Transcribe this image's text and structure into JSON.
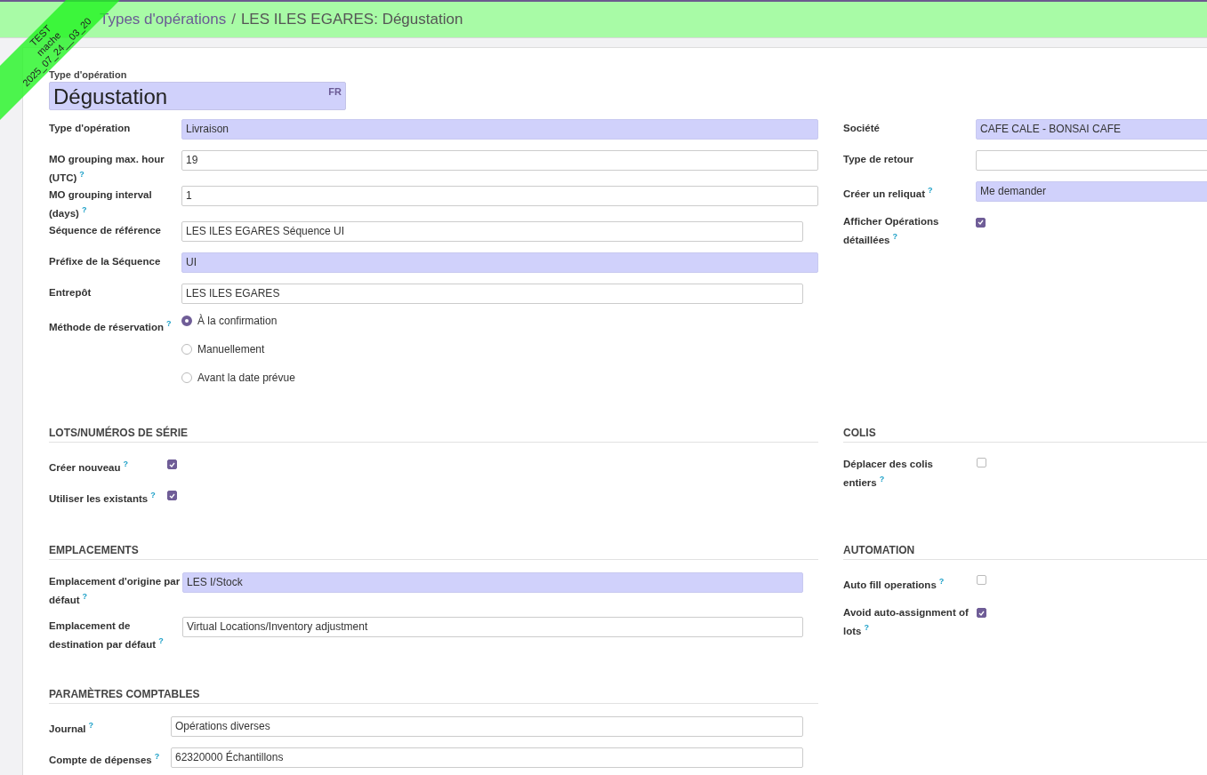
{
  "ribbon": {
    "lines": [
      "TEST",
      "mache",
      "2025_07_24__03_20"
    ]
  },
  "breadcrumb": [
    {
      "label": "Types d'opérations",
      "link": true
    },
    {
      "separator": "/",
      "label": "LES ILES EGARES: Dégustation",
      "link": false
    }
  ],
  "title_field": {
    "label": "Type d'opération",
    "value": "Dégustation",
    "lang": "FR"
  },
  "main_left": [
    {
      "label": "Type d'opération",
      "kind": "text",
      "value": "Livraison",
      "required": true
    },
    {
      "label": "MO grouping max. hour (UTC)",
      "help": "?",
      "kind": "text",
      "value": "19",
      "required": false
    },
    {
      "label": "MO grouping interval (days)",
      "help": "?",
      "kind": "text",
      "value": "1",
      "required": false
    },
    {
      "label": "Séquence de référence",
      "kind": "relation",
      "value": "LES ILES EGARES Séquence UI",
      "required": false
    },
    {
      "label": "Préfixe de la Séquence",
      "kind": "text",
      "value": "UI",
      "required": true
    },
    {
      "label": "Entrepôt",
      "kind": "relation",
      "value": "LES ILES EGARES",
      "required": false
    },
    {
      "label": "Méthode de réservation",
      "help": "?",
      "kind": "radio",
      "options": [
        {
          "label": "À la confirmation",
          "selected": true
        },
        {
          "label": "Manuellement",
          "selected": false
        },
        {
          "label": "Avant la date prévue",
          "selected": false
        }
      ]
    }
  ],
  "main_right": [
    {
      "label": "Société",
      "kind": "text",
      "value": "CAFE CALE - BONSAI CAFE",
      "required": true
    },
    {
      "label": "Type de retour",
      "kind": "text",
      "required": false
    },
    {
      "label": "Créer un reliquat",
      "help": "?",
      "kind": "text",
      "value": "Me demander",
      "required": true
    },
    {
      "label": "Afficher Opérations détaillées",
      "help": "?",
      "kind": "checkbox",
      "checked": true
    }
  ],
  "sections": [
    {
      "title": "LOTS/NUMÉROS DE SÉRIE",
      "fields": [
        {
          "label": "Créer nouveau",
          "help": "?",
          "kind": "checkbox",
          "checked": true
        },
        {
          "label": "Utiliser les existants",
          "help": "?",
          "kind": "checkbox",
          "checked": true
        }
      ]
    },
    {
      "title": "COLIS",
      "fields": [
        {
          "label": "Déplacer des colis entiers",
          "help": "?",
          "kind": "checkbox",
          "checked": false
        }
      ]
    },
    {
      "title": "EMPLACEMENTS",
      "fields": [
        {
          "label": "Emplacement d'origine par défaut",
          "help": "?",
          "kind": "relation",
          "value": "LES I/Stock",
          "required": true
        },
        {
          "label": "Emplacement de destination par défaut",
          "help": "?",
          "kind": "relation",
          "value": "Virtual Locations/Inventory adjustment",
          "required": false
        }
      ]
    },
    {
      "title": "AUTOMATION",
      "fields": [
        {
          "label": "Auto fill operations",
          "help": "?",
          "kind": "checkbox",
          "checked": false
        },
        {
          "label": "Avoid auto-assignment of lots",
          "help": "?",
          "kind": "checkbox",
          "checked": true
        }
      ]
    },
    {
      "title": "PARAMÈTRES COMPTABLES",
      "fields": [
        {
          "label": "Journal",
          "help": "?",
          "kind": "relation",
          "value": "Opérations diverses",
          "required": false
        },
        {
          "label": "Compte de dépenses",
          "help": "?",
          "kind": "relation",
          "value": "62320000 Échantillons",
          "required": false
        }
      ]
    }
  ]
}
